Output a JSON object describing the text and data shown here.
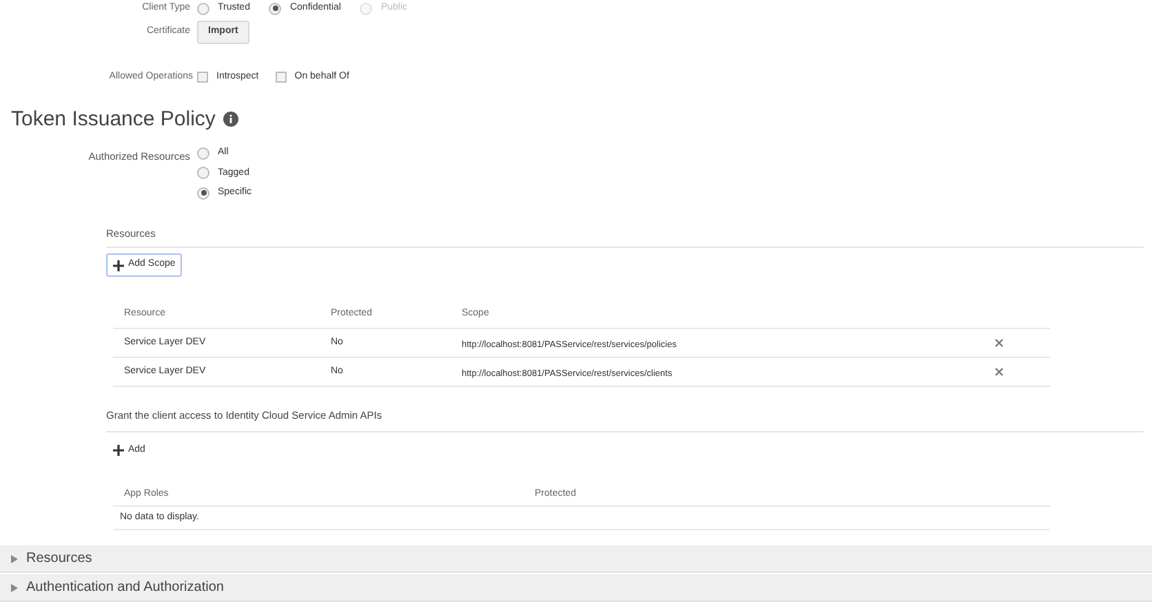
{
  "client_type": {
    "label": "Client Type",
    "options": [
      {
        "label": "Trusted",
        "selected": false,
        "disabled": false
      },
      {
        "label": "Confidential",
        "selected": true,
        "disabled": false
      },
      {
        "label": "Public",
        "selected": false,
        "disabled": true
      }
    ]
  },
  "certificate": {
    "label": "Certificate",
    "button": "Import"
  },
  "allowed_operations": {
    "label": "Allowed Operations",
    "options": [
      {
        "label": "Introspect",
        "checked": false
      },
      {
        "label": "On behalf Of",
        "checked": false
      }
    ]
  },
  "token_issuance_policy": {
    "title": "Token Issuance Policy",
    "authorized_resources": {
      "label": "Authorized Resources",
      "options": [
        {
          "label": "All",
          "selected": false
        },
        {
          "label": "Tagged",
          "selected": false
        },
        {
          "label": "Specific",
          "selected": true
        }
      ]
    },
    "resources": {
      "title": "Resources",
      "add_button": "Add Scope",
      "columns": [
        "Resource",
        "Protected",
        "Scope"
      ],
      "rows": [
        {
          "resource": "Service Layer DEV",
          "protected": "No",
          "scope": "http://localhost:8081/PASService/rest/services/policies"
        },
        {
          "resource": "Service Layer DEV",
          "protected": "No",
          "scope": "http://localhost:8081/PASService/rest/services/clients"
        }
      ]
    },
    "admin_apis": {
      "title": "Grant the client access to Identity Cloud Service Admin APIs",
      "add_button": "Add",
      "columns": [
        "App Roles",
        "Protected"
      ],
      "empty": "No data to display."
    }
  },
  "sections": [
    {
      "label": "Resources",
      "expanded": false
    },
    {
      "label": "Authentication and Authorization",
      "expanded": false
    }
  ]
}
